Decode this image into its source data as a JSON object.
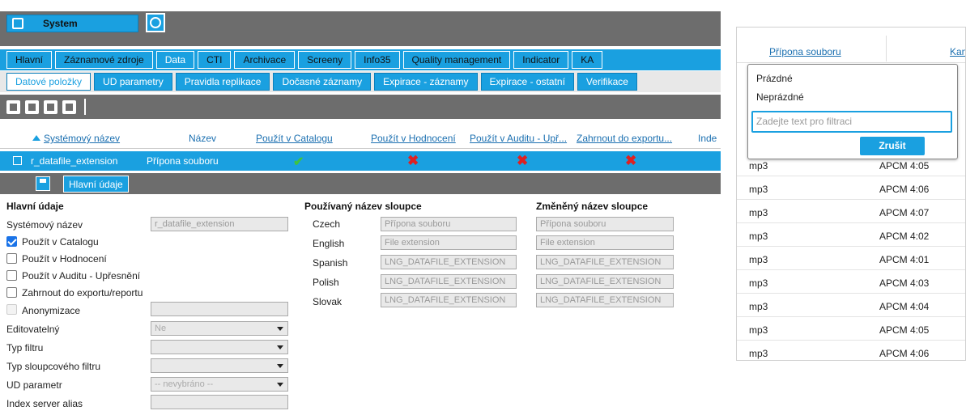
{
  "app": {
    "system_label": "System"
  },
  "tabs_main": [
    "Hlavní",
    "Záznamové zdroje",
    "Data",
    "CTI",
    "Archivace",
    "Screeny",
    "Info35",
    "Quality management",
    "Indicator",
    "KA"
  ],
  "tabs_sub": [
    "Datové položky",
    "UD parametry",
    "Pravidla replikace",
    "Dočasné záznamy",
    "Expirace - záznamy",
    "Expirace - ostatní",
    "Verifikace"
  ],
  "columns": {
    "system_name": "Systémový název",
    "name": "Název",
    "catalog": "Použít v Catalogu",
    "rating": "Použít v Hodnocení",
    "audit": "Použít v Auditu - Upř...",
    "export": "Zahrnout do exportu...",
    "index": "Inde"
  },
  "selected_row": {
    "system_name": "r_datafile_extension",
    "name": "Přípona souboru",
    "catalog_mark": "✔",
    "rating_mark": "✖",
    "audit_mark": "✖",
    "export_mark": "✖"
  },
  "detail": {
    "tab_label": "Hlavní údaje",
    "section_main": "Hlavní údaje",
    "system_name_label": "Systémový název",
    "system_name_value": "r_datafile_extension",
    "use_catalog": "Použít v Catalogu",
    "use_rating": "Použít v Hodnocení",
    "use_audit": "Použít v Auditu - Upřesnění",
    "include_export": "Zahrnout do exportu/reportu",
    "anonymization": "Anonymizace",
    "editable_label": "Editovatelný",
    "editable_value": "Ne",
    "filter_type_label": "Typ filtru",
    "column_filter_type_label": "Typ sloupcového filtru",
    "ud_param_label": "UD parametr",
    "ud_param_value": "-- nevybráno --",
    "index_alias_label": "Index server alias",
    "used_col_title": "Používaný název sloupce",
    "changed_col_title": "Změněný název sloupce",
    "languages": [
      {
        "lang": "Czech",
        "used": "Přípona souboru",
        "changed": "Přípona souboru"
      },
      {
        "lang": "English",
        "used": "File extension",
        "changed": "File extension"
      },
      {
        "lang": "Spanish",
        "used": "LNG_DATAFILE_EXTENSION",
        "changed": "LNG_DATAFILE_EXTENSION"
      },
      {
        "lang": "Polish",
        "used": "LNG_DATAFILE_EXTENSION",
        "changed": "LNG_DATAFILE_EXTENSION"
      },
      {
        "lang": "Slovak",
        "used": "LNG_DATAFILE_EXTENSION",
        "changed": "LNG_DATAFILE_EXTENSION"
      }
    ]
  },
  "right": {
    "col_extension": "Přípona souboru",
    "col_channel": "Kanál",
    "popup": {
      "opt_empty": "Prázdné",
      "opt_nonempty": "Neprázdné",
      "filter_placeholder": "Zadejte text pro filtraci",
      "cancel_label": "Zrušit"
    },
    "rows": [
      {
        "ext": "mp3",
        "codec": "APCM 4:05"
      },
      {
        "ext": "mp3",
        "codec": "APCM 4:06"
      },
      {
        "ext": "mp3",
        "codec": "APCM 4:07"
      },
      {
        "ext": "mp3",
        "codec": "APCM 4:02"
      },
      {
        "ext": "mp3",
        "codec": "APCM 4:01"
      },
      {
        "ext": "mp3",
        "codec": "APCM 4:03"
      },
      {
        "ext": "mp3",
        "codec": "APCM 4:04"
      },
      {
        "ext": "mp3",
        "codec": "APCM 4:05"
      },
      {
        "ext": "mp3",
        "codec": "APCM 4:06"
      }
    ]
  }
}
